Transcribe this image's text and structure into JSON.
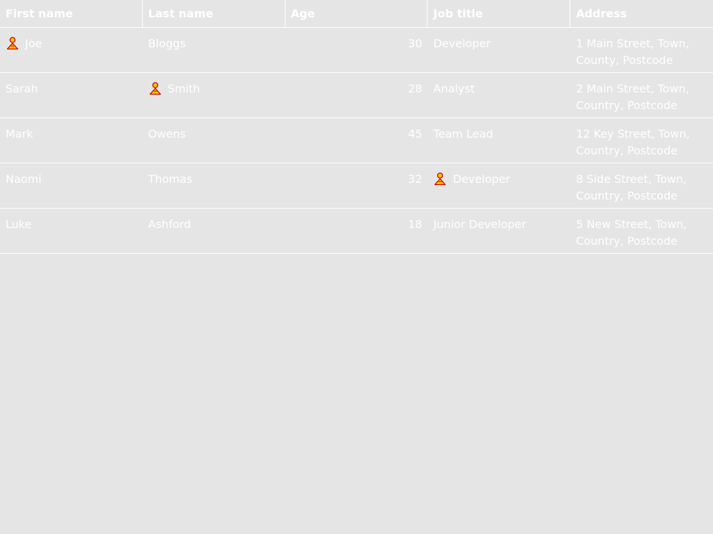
{
  "table": {
    "columns": [
      "First name",
      "Last name",
      "Age",
      "Job title",
      "Address"
    ],
    "rows": [
      {
        "first_name": "Joe",
        "last_name": "Bloggs",
        "age": "30",
        "job_title": "Developer",
        "address": "1 Main Street, Town, County, Postcode",
        "icon_column": "first_name"
      },
      {
        "first_name": "Sarah",
        "last_name": "Smith",
        "age": "28",
        "job_title": "Analyst",
        "address": "2 Main Street, Town, Country, Postcode",
        "icon_column": "last_name"
      },
      {
        "first_name": "Mark",
        "last_name": "Owens",
        "age": "45",
        "job_title": "Team Lead",
        "address": "12 Key Street, Town, Country, Postcode",
        "icon_column": ""
      },
      {
        "first_name": "Naomi",
        "last_name": "Thomas",
        "age": "32",
        "job_title": "Developer",
        "address": "8 Side Street, Town, Country, Postcode",
        "icon_column": "job_title"
      },
      {
        "first_name": "Luke",
        "last_name": "Ashford",
        "age": "18",
        "job_title": "Junior Developer",
        "address": "5 New Street, Town, Country, Postcode",
        "icon_column": ""
      }
    ]
  },
  "icons": {
    "row_icon": "person-icon"
  },
  "colors": {
    "background": "#e5e5e5",
    "text": "#ffffff",
    "icon_body": "#f5c400",
    "icon_outline": "#cc0000"
  }
}
